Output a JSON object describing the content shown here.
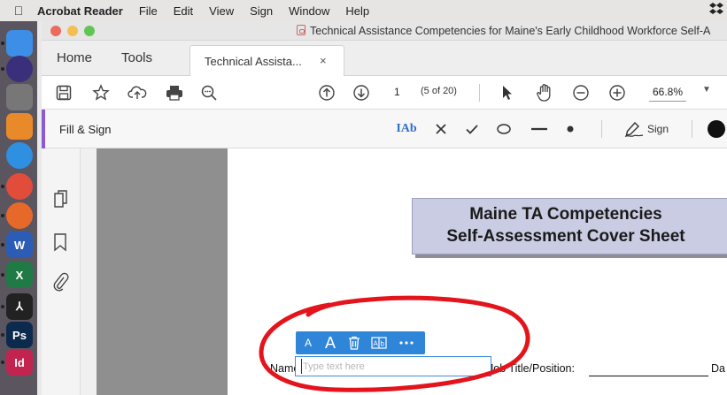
{
  "menubar": {
    "app_name": "Acrobat Reader",
    "items": [
      "File",
      "Edit",
      "View",
      "Sign",
      "Window",
      "Help"
    ]
  },
  "dock": {
    "apps": [
      {
        "name": "Finder",
        "color": "#3d8ee6"
      },
      {
        "name": "Siri",
        "color": "#3a2f7a"
      },
      {
        "name": "Launchpad",
        "color": "#777"
      },
      {
        "name": "Calculator",
        "color": "#e88a2a"
      },
      {
        "name": "Safari",
        "color": "#2f8fe0"
      },
      {
        "name": "Chrome",
        "color": "#e24c3a"
      },
      {
        "name": "Firefox",
        "color": "#e6692a"
      },
      {
        "name": "Word",
        "color": "#2b5cb6",
        "glyph": "W"
      },
      {
        "name": "Excel",
        "color": "#1f7a45",
        "glyph": "X"
      },
      {
        "name": "Acrobat",
        "color": "#222",
        "glyph": "⅄"
      },
      {
        "name": "Photoshop",
        "color": "#0c2a4d",
        "glyph": "Ps"
      },
      {
        "name": "InDesign",
        "color": "#c3244f",
        "glyph": "Id"
      }
    ]
  },
  "window": {
    "title": "Technical Assistance Competencies for Maine's Early Childhood Workforce Self-A"
  },
  "tabs": {
    "home": "Home",
    "tools": "Tools",
    "document": "Technical Assista...",
    "close": "×"
  },
  "toolbar": {
    "page_number": "1",
    "page_of": "(5 of 20)",
    "zoom": "66.8%"
  },
  "fill_sign": {
    "label": "Fill & Sign",
    "text_tool_label": "IAb",
    "sign_label": "Sign",
    "accent_color": "#8b5bd4",
    "ink_color": "#111111"
  },
  "document": {
    "heading_line1": "Maine TA Competencies",
    "heading_line2": "Self-Assessment Cover Sheet",
    "name_label": "Name:",
    "job_label": "Job Title/Position:",
    "date_label": "Da"
  },
  "text_popup": {
    "small_a": "A",
    "large_a": "A",
    "field_placeholder": "Type text here",
    "field_value": ""
  },
  "annotation": {
    "circle_color": "#e3141b"
  }
}
